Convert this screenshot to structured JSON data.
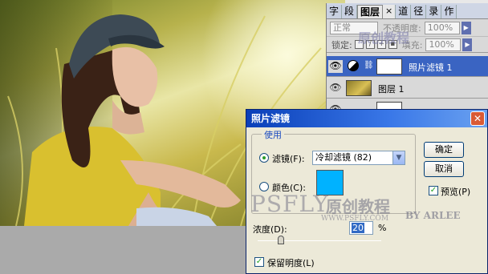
{
  "layers_panel": {
    "tabs": [
      "字",
      "段",
      "图层",
      "×",
      "道",
      "径",
      "录",
      "作"
    ],
    "blend_mode": "正常",
    "opacity_label": "不透明度:",
    "opacity_value": "100%",
    "lock_label": "锁定:",
    "fill_label": "填充:",
    "fill_value": "100%",
    "layers": [
      {
        "name": "照片滤镜 1",
        "selected": true
      },
      {
        "name": "图层 1",
        "selected": false
      },
      {
        "name": "…",
        "selected": false
      }
    ]
  },
  "dialog": {
    "title": "照片滤镜",
    "close_symbol": "✕",
    "group_label": "使用",
    "filter_radio_label": "滤镜(F):",
    "filter_value": "冷却滤镜 (82)",
    "color_radio_label": "颜色(C):",
    "swatch_color": "#00b2ff",
    "ok_label": "确定",
    "cancel_label": "取消",
    "preview_label": "预览(P)",
    "density_label": "浓度(D):",
    "density_value": "20",
    "density_unit": "%",
    "preserve_label": "保留明度(L)"
  },
  "watermark": {
    "brand": "PSFLY",
    "cn": "原创教程",
    "site": "WWW.PSFLY.COM",
    "author": "BY ARLEE",
    "panel_cn": "原创教程"
  },
  "colors": {
    "title_blue": "#0a3fb8",
    "selected_layer": "#3a64c2",
    "swatch": "#00b2ff"
  }
}
